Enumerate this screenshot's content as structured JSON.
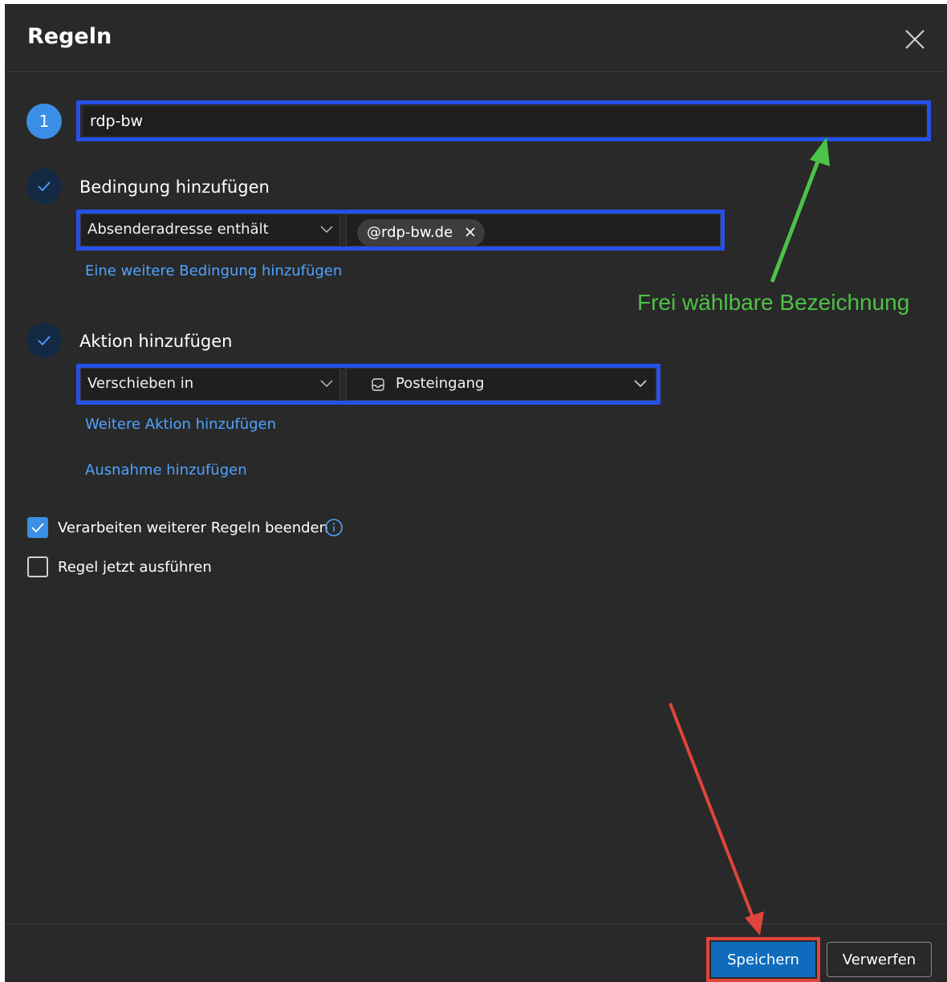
{
  "dialog": {
    "title": "Regeln",
    "close_icon": "close-icon"
  },
  "step1": {
    "number": "1",
    "rule_name_value": "rdp-bw"
  },
  "condition": {
    "label": "Bedingung hinzufügen",
    "select_value": "Absenderadresse enthält",
    "chip_value": "@rdp-bw.de",
    "add_link": "Eine weitere Bedingung hinzufügen"
  },
  "action": {
    "label": "Aktion hinzufügen",
    "select_value": "Verschieben in",
    "folder_value": "Posteingang",
    "folder_icon": "inbox-icon",
    "add_link": "Weitere Aktion hinzufügen"
  },
  "exception": {
    "add_link": "Ausnahme hinzufügen"
  },
  "options": {
    "stop_processing": {
      "label": "Verarbeiten weiterer Regeln beenden",
      "checked": true
    },
    "run_now": {
      "label": "Regel jetzt ausführen",
      "checked": false
    }
  },
  "annotation": {
    "text": "Frei wählbare Bezeichnung",
    "color": "#4cc246",
    "arrow_color_red": "#e0443b"
  },
  "footer": {
    "save_label": "Speichern",
    "discard_label": "Verwerfen"
  },
  "colors": {
    "background": "#292929",
    "accent": "#3a8ee6",
    "link": "#4fa3ff",
    "highlight": "#2551e8",
    "primary_button": "#0f6cbd"
  }
}
